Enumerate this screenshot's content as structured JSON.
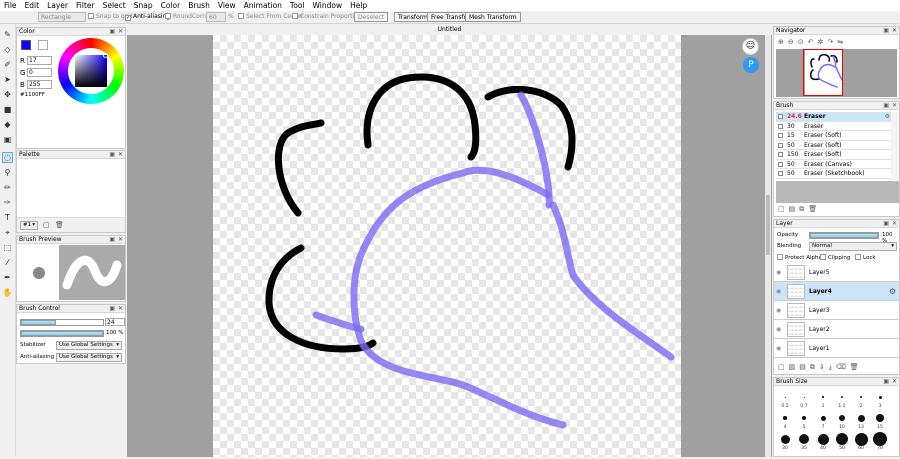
{
  "menu": [
    "File",
    "Edit",
    "Layer",
    "Filter",
    "Select",
    "Snap",
    "Color",
    "Brush",
    "View",
    "Animation",
    "Tool",
    "Window",
    "Help"
  ],
  "options": {
    "shape": "Rectangle",
    "snap_to_grid": "Snap to grid",
    "anti_aliasing": "Anti-aliasing",
    "round_corner": "RoundCorner",
    "round_value": "60",
    "percent": "%",
    "select_from_center": "Select From Center",
    "constrain": "Constrain Proportions",
    "deselect": "Deselect",
    "transform": "Transform",
    "free_transform": "Free Transform",
    "mesh_transform": "Mesh Transform"
  },
  "document_tab": "Untitled",
  "color_panel": {
    "title": "Color",
    "r_label": "R",
    "r": "17",
    "g_label": "G",
    "g": "0",
    "b_label": "B",
    "b": "255",
    "hex": "#1100FF",
    "fg": "#1100ff"
  },
  "palette_panel": {
    "title": "Palette",
    "selector": "#1"
  },
  "brush_preview": {
    "title": "Brush Preview"
  },
  "brush_control": {
    "title": "Brush Control",
    "size": "24",
    "opacity": "100 %",
    "opacity_fraction": 1.0,
    "size_fraction": 0.43,
    "stabilizer_label": "Stabilizer",
    "stabilizer": "Use Global Settings",
    "aa_label": "Anti-aliasing",
    "aa": "Use Global Settings"
  },
  "navigator": {
    "title": "Navigator"
  },
  "brush_panel": {
    "title": "Brush",
    "items": [
      {
        "size": "24.6",
        "name": "Eraser",
        "selected": true
      },
      {
        "size": "30",
        "name": "Eraser"
      },
      {
        "size": "15",
        "name": "Eraser (Soft)"
      },
      {
        "size": "50",
        "name": "Eraser (Soft)"
      },
      {
        "size": "150",
        "name": "Eraser (Soft)"
      },
      {
        "size": "50",
        "name": "Eraser (Canvas)"
      },
      {
        "size": "50",
        "name": "Eraser (Sketchbook)"
      }
    ]
  },
  "layer_panel": {
    "title": "Layer",
    "opacity_label": "Opacity",
    "opacity": "100 %",
    "opacity_fraction": 1.0,
    "blending_label": "Blending",
    "blending": "Normal",
    "protect_alpha": "Protect Alpha",
    "clipping": "Clipping",
    "lock": "Lock",
    "layers": [
      {
        "name": "Layer5"
      },
      {
        "name": "Layer4",
        "selected": true
      },
      {
        "name": "Layer3"
      },
      {
        "name": "Layer2"
      },
      {
        "name": "Layer1"
      }
    ]
  },
  "brush_size": {
    "title": "Brush Size",
    "rows": [
      [
        "0.5",
        "0.7",
        "1",
        "1.5",
        "2",
        "3"
      ],
      [
        "4",
        "5",
        "7",
        "10",
        "13",
        "15"
      ],
      [
        "30",
        "35",
        "40",
        "50",
        "60",
        "70"
      ]
    ]
  },
  "colors": {
    "ink": "#000000",
    "blue_stroke": "#7b6cf0",
    "accent": "#cce4f7"
  }
}
